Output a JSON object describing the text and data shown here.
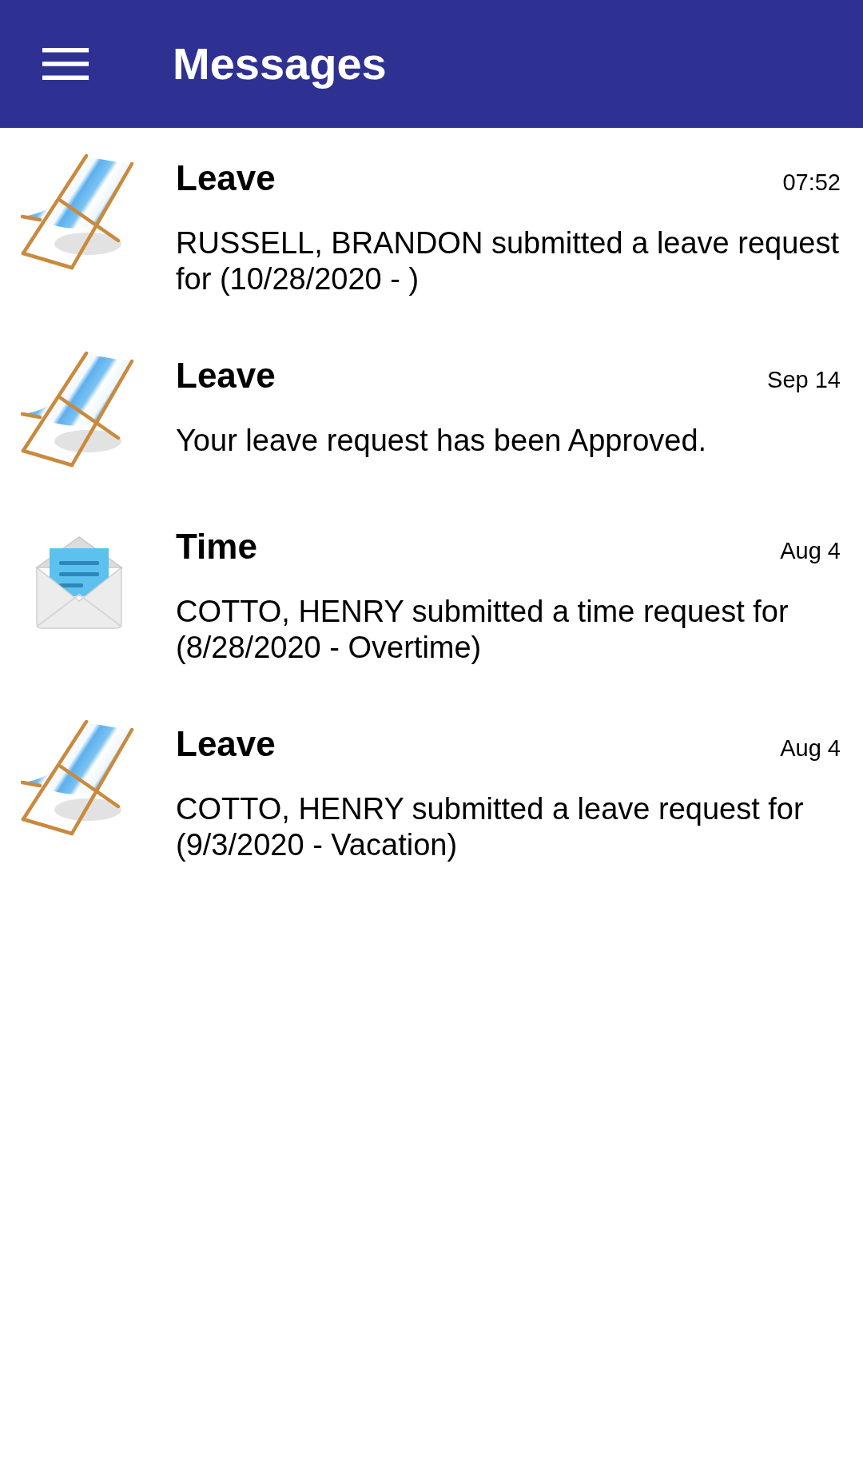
{
  "app_bar": {
    "title": "Messages"
  },
  "messages": [
    {
      "kind": "leave",
      "title": "Leave",
      "time": "07:52",
      "text": "RUSSELL, BRANDON submitted a leave request for (10/28/2020 - )"
    },
    {
      "kind": "leave",
      "title": "Leave",
      "time": "Sep 14",
      "text": "Your leave request has been Approved."
    },
    {
      "kind": "time",
      "title": "Time",
      "time": "Aug 4",
      "text": "COTTO, HENRY submitted a time request for (8/28/2020 - Overtime)"
    },
    {
      "kind": "leave",
      "title": "Leave",
      "time": "Aug 4",
      "text": "COTTO, HENRY submitted a leave request for (9/3/2020 - Vacation)"
    }
  ]
}
